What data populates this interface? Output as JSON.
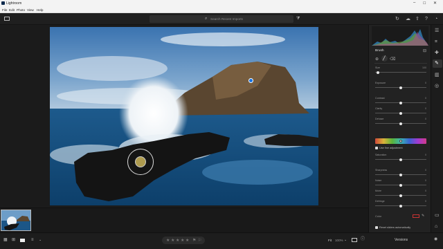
{
  "app": {
    "title": "Lightroom"
  },
  "menu": [
    "File",
    "Edit",
    "Photo",
    "View",
    "Help"
  ],
  "search": {
    "placeholder": "Search Recent Imports"
  },
  "panel": {
    "title": "Brush",
    "checkbox_use_fine_adjustment": "Use fine adjustment",
    "reset_sliders_label": "Reset sliders automatically",
    "sliders": [
      {
        "label": "Size",
        "value": "100",
        "pos": 0.06
      },
      {
        "label": "Exposure",
        "value": "0",
        "pos": 0.5
      },
      {
        "label": "Contrast",
        "value": "0",
        "pos": 0.5
      },
      {
        "label": "Clarity",
        "value": "0",
        "pos": 0.5
      },
      {
        "label": "Dehaze",
        "value": "0",
        "pos": 0.5
      },
      {
        "label": "Saturation",
        "value": "0",
        "pos": 0.5
      },
      {
        "label": "Sharpness",
        "value": "0",
        "pos": 0.5
      },
      {
        "label": "Noise",
        "value": "0",
        "pos": 0.5
      },
      {
        "label": "Moire",
        "value": "0",
        "pos": 0.5
      },
      {
        "label": "Defringe",
        "value": "0",
        "pos": 0.5
      }
    ],
    "color_label": "Color"
  },
  "bottom": {
    "fit_label": "Fit",
    "zoom_label": "100%",
    "versions_label": "Versions"
  },
  "colors": {
    "accent": "#1473e6",
    "panel_bg": "#222222"
  }
}
